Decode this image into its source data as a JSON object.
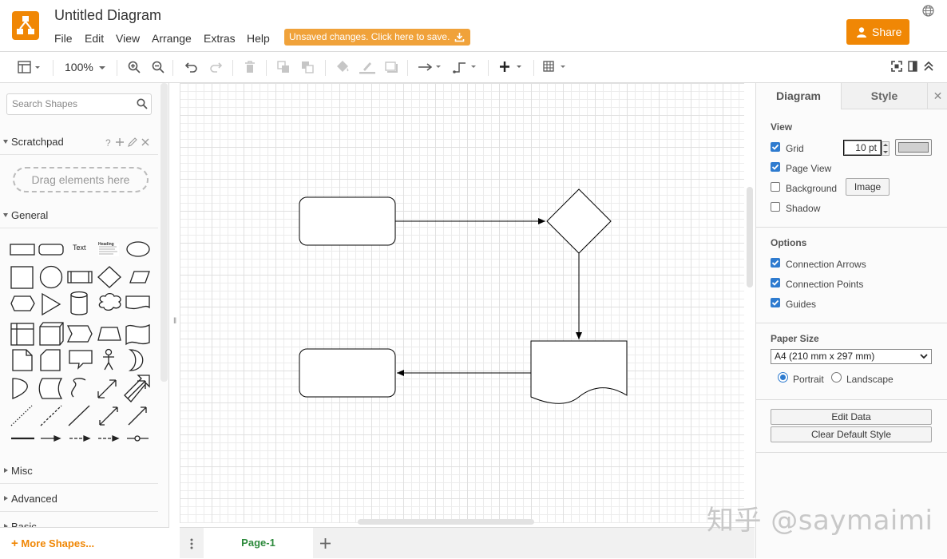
{
  "app": {
    "title": "Untitled Diagram",
    "menu": [
      "File",
      "Edit",
      "View",
      "Arrange",
      "Extras",
      "Help"
    ],
    "unsaved_notice": "Unsaved changes. Click here to save.",
    "share_label": "Share",
    "brand_color": "#f08705"
  },
  "toolbar": {
    "zoom": "100%"
  },
  "sidebar": {
    "search_placeholder": "Search Shapes",
    "scratchpad_title": "Scratchpad",
    "scratchpad_hint": "Drag elements here",
    "general_title": "General",
    "text_shape_label": "Text",
    "heading_shape_label": "Heading",
    "collapsed_sections": [
      "Misc",
      "Advanced",
      "Basic"
    ],
    "more_shapes": "More Shapes..."
  },
  "format_panel": {
    "tabs": [
      "Diagram",
      "Style"
    ],
    "view_heading": "View",
    "grid_label": "Grid",
    "grid_size": "10 pt",
    "page_view_label": "Page View",
    "background_label": "Background",
    "image_button": "Image",
    "shadow_label": "Shadow",
    "options_heading": "Options",
    "connection_arrows_label": "Connection Arrows",
    "connection_points_label": "Connection Points",
    "guides_label": "Guides",
    "paper_size_heading": "Paper Size",
    "paper_size_value": "A4 (210 mm x 297 mm)",
    "portrait_label": "Portrait",
    "landscape_label": "Landscape",
    "edit_data_button": "Edit Data",
    "clear_style_button": "Clear Default Style",
    "checks": {
      "grid": true,
      "page_view": true,
      "background": false,
      "shadow": false,
      "connection_arrows": true,
      "connection_points": true,
      "guides": true
    },
    "orientation": "portrait"
  },
  "footer": {
    "page_tab": "Page-1"
  },
  "watermark": "知乎 @saymaimi"
}
